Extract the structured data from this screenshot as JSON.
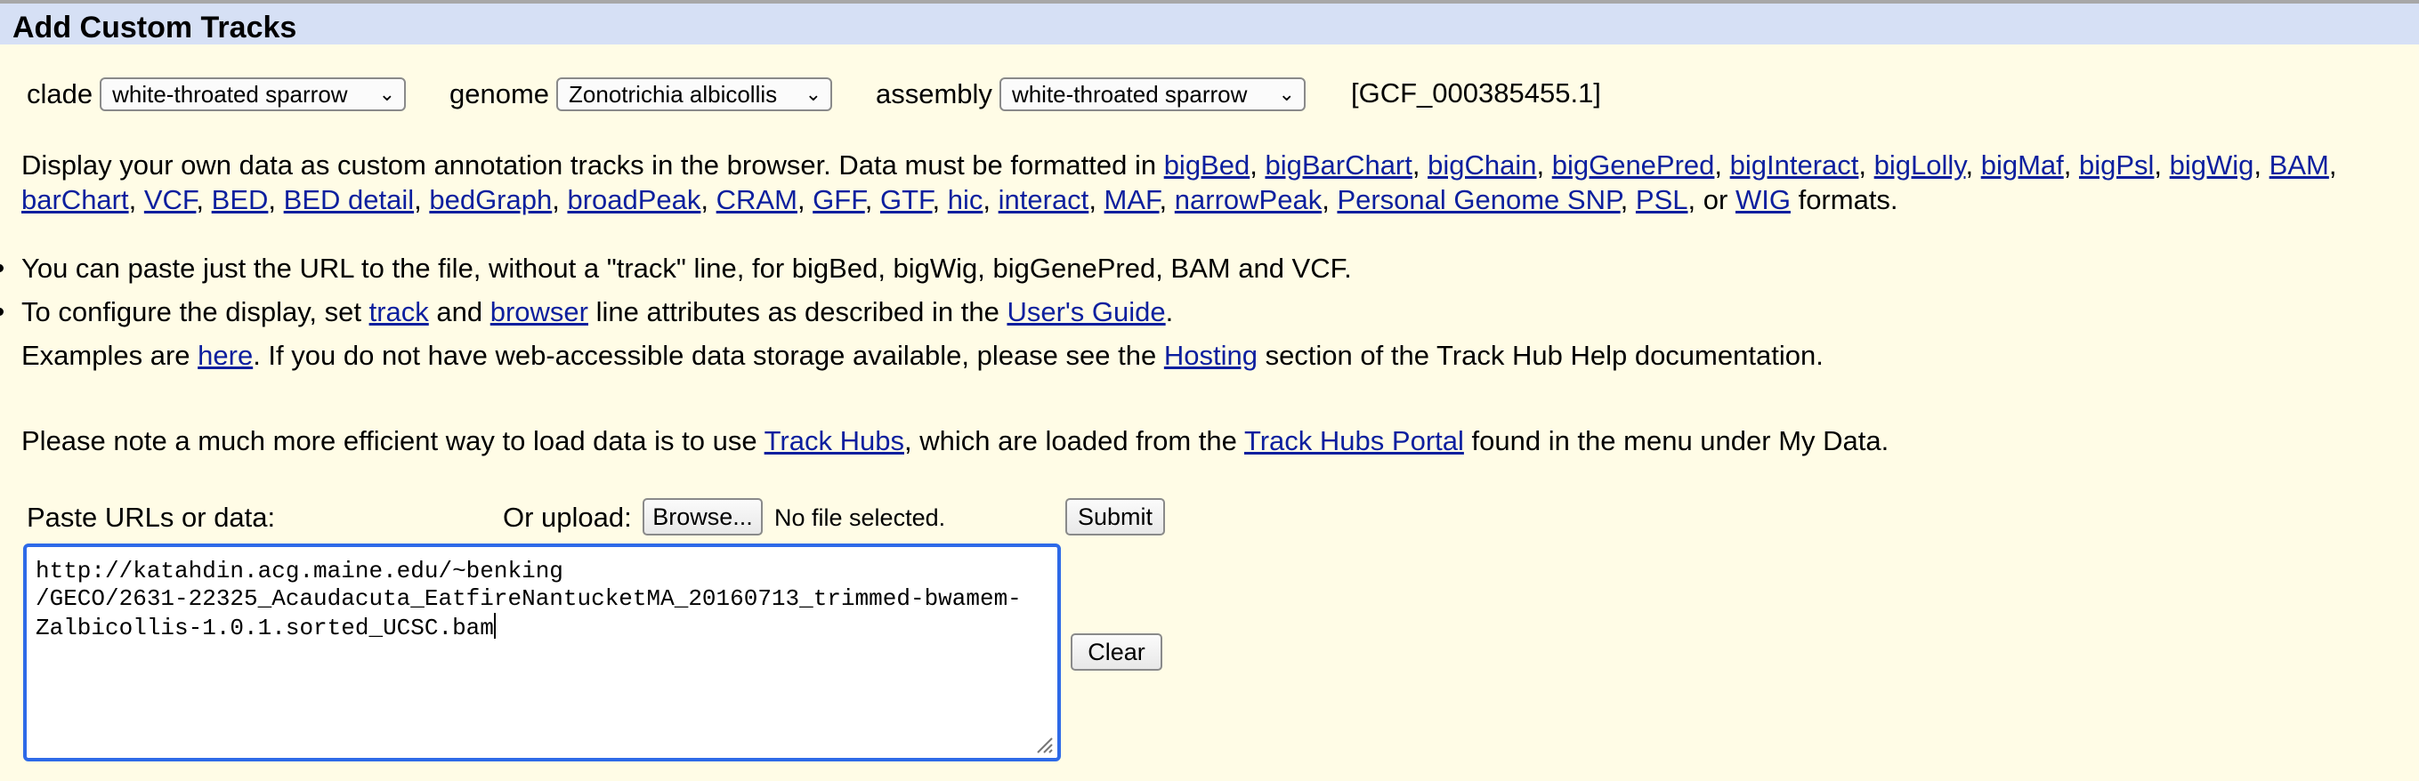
{
  "header": {
    "title": "Add Custom Tracks"
  },
  "selectors": {
    "clade_label": "clade",
    "clade_value": "white-throated sparrow",
    "genome_label": "genome",
    "genome_value": "Zonotrichia albicollis",
    "assembly_label": "assembly",
    "assembly_value": "white-throated sparrow",
    "assembly_accession": "[GCF_000385455.1]"
  },
  "intro": {
    "text_start": "Display your own data as custom annotation tracks in the browser. Data must be formatted in ",
    "formats": [
      "bigBed",
      "bigBarChart",
      "bigChain",
      "bigGenePred",
      "bigInteract",
      "bigLolly",
      "bigMaf",
      "bigPsl",
      "bigWig",
      "BAM",
      "barChart",
      "VCF",
      "BED",
      "BED detail",
      "bedGraph",
      "broadPeak",
      "CRAM",
      "GFF",
      "GTF",
      "hic",
      "interact",
      "MAF",
      "narrowPeak",
      "Personal Genome SNP",
      "PSL",
      "WIG"
    ],
    "or_word": "or",
    "text_end": "formats."
  },
  "bullets": {
    "b1": "You can paste just the URL to the file, without a \"track\" line, for bigBed, bigWig, bigGenePred, BAM and VCF.",
    "b2_start": "To configure the display, set ",
    "b2_link_track": "track",
    "b2_and": " and ",
    "b2_link_browser": "browser",
    "b2_mid": " line attributes as described in the ",
    "b2_link_guide": "User's Guide",
    "b2_end": "."
  },
  "examples": {
    "start": "Examples are ",
    "link_here": "here",
    "mid": ". If you do not have web-accessible data storage available, please see the ",
    "link_hosting": "Hosting",
    "end": " section of the Track Hub Help documentation."
  },
  "note": {
    "start": "Please note a much more efficient way to load data is to use ",
    "link_hubs": "Track Hubs",
    "mid": ", which are loaded from the ",
    "link_portal": "Track Hubs Portal",
    "end": " found in the menu under My Data."
  },
  "form": {
    "paste_label": "Paste URLs or data:",
    "upload_label": "Or upload:",
    "browse_label": "Browse...",
    "file_status": "No file selected.",
    "submit_label": "Submit",
    "clear_label": "Clear",
    "textarea_line1": "http://katahdin.acg.maine.edu/~benking",
    "textarea_line2": "/GECO/2631-22325_Acaudacuta_EatfireNantucketMA_20160713_trimmed-bwamem-",
    "textarea_line3": "Zalbicollis-1.0.1.sorted_UCSC.bam"
  },
  "colors": {
    "background": "#fffce6",
    "header_bg": "#d6e0f5",
    "link": "#0c1f9e",
    "focus_border": "#2e6ae8"
  }
}
